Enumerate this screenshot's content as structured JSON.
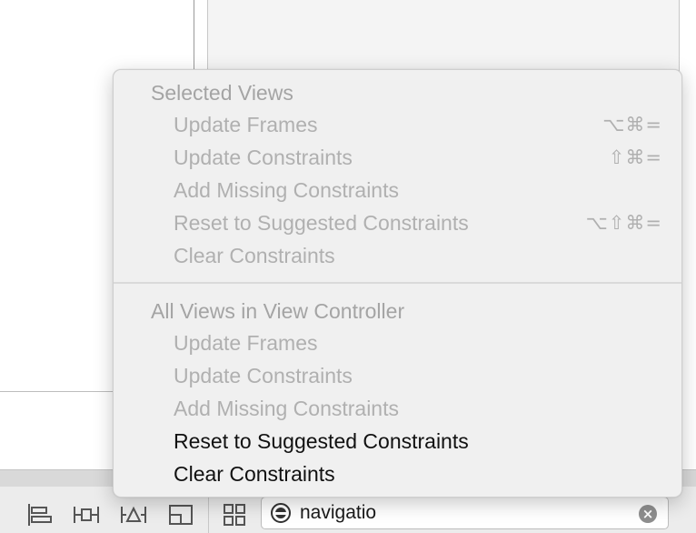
{
  "menu": {
    "sections": [
      {
        "header": "Selected Views",
        "items": [
          {
            "label": "Update Frames",
            "shortcut": "⌥⌘=",
            "enabled": false
          },
          {
            "label": "Update Constraints",
            "shortcut": "⇧⌘=",
            "enabled": false
          },
          {
            "label": "Add Missing Constraints",
            "shortcut": "",
            "enabled": false
          },
          {
            "label": "Reset to Suggested Constraints",
            "shortcut": "⌥⇧⌘=",
            "enabled": false
          },
          {
            "label": "Clear Constraints",
            "shortcut": "",
            "enabled": false
          }
        ]
      },
      {
        "header": "All Views in View Controller",
        "items": [
          {
            "label": "Update Frames",
            "shortcut": "",
            "enabled": false
          },
          {
            "label": "Update Constraints",
            "shortcut": "",
            "enabled": false
          },
          {
            "label": "Add Missing Constraints",
            "shortcut": "",
            "enabled": false
          },
          {
            "label": "Reset to Suggested Constraints",
            "shortcut": "",
            "enabled": true
          },
          {
            "label": "Clear Constraints",
            "shortcut": "",
            "enabled": true
          }
        ]
      }
    ]
  },
  "toolbar": {
    "icons": [
      "align-icon",
      "pin-icon",
      "resolve-auto-layout-issues-icon",
      "resizing-behavior-icon",
      "grid-view-icon"
    ]
  },
  "search": {
    "value": "navigatio",
    "scope_icon": "filter-scope-icon",
    "clear_icon": "clear-search-icon"
  },
  "colors": {
    "disabled_text": "#b0b0b0",
    "header_text": "#a4a4a4",
    "enabled_text": "#111111",
    "menu_background": "#f0f0f0"
  }
}
